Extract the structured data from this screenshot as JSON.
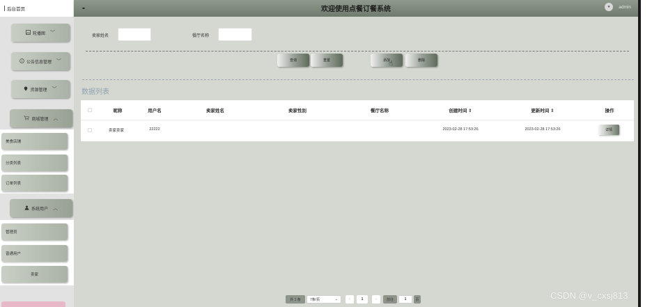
{
  "sidebar": {
    "home": "后台首页",
    "menus": [
      {
        "label": "轮播图",
        "icon": "image-icon"
      },
      {
        "label": "公告信息管理",
        "icon": "info-icon"
      },
      {
        "label": "资源管理",
        "icon": "location-icon"
      },
      {
        "label": "商城管理",
        "icon": "cart-icon"
      },
      {
        "label": "系统用户",
        "icon": "user-icon"
      }
    ],
    "shop_items": [
      "美食店铺",
      "分类列表",
      "订单列表"
    ],
    "user_items": [
      "管理员",
      "普通用户",
      "卖家"
    ]
  },
  "header": {
    "toggle": "▪▪",
    "title": "欢迎使用点餐订餐系统",
    "user": "admin"
  },
  "search": {
    "seller_name_label": "卖家姓名",
    "restaurant_label": "餐厅名称"
  },
  "actions": {
    "query": "查询",
    "reset": "重置",
    "add": "添加",
    "delete": "删除"
  },
  "list": {
    "title": "数据列表",
    "columns": [
      "昵称",
      "用户名",
      "卖家姓名",
      "卖家性别",
      "餐厅名称",
      "创建时间 ⇕",
      "更新时间 ⇕",
      "操作"
    ],
    "rows": [
      {
        "nickname": "卖家卖家",
        "username": "22222",
        "seller_name": "",
        "seller_gender": "",
        "restaurant": "",
        "created": "2023-02-28 17:53:26",
        "updated": "2023-02-28 17:53:26",
        "action": "详情"
      }
    ]
  },
  "pager": {
    "total": "共 1 条",
    "page_size": "7条/页",
    "prev": "‹",
    "current": "1",
    "next": "›",
    "goto": "前往",
    "jump_value": "1",
    "page_unit": "页"
  },
  "watermark": "CSDN @v_cxsj813"
}
